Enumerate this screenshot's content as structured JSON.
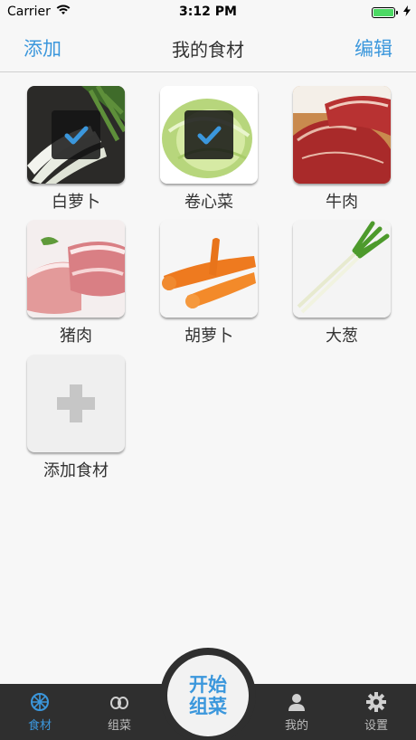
{
  "status": {
    "carrier": "Carrier",
    "time": "3:12 PM"
  },
  "nav": {
    "left": "添加",
    "title": "我的食材",
    "right": "编辑"
  },
  "items": [
    {
      "label": "白萝卜",
      "checked": true
    },
    {
      "label": "卷心菜",
      "checked": true
    },
    {
      "label": "牛肉",
      "checked": false
    },
    {
      "label": "猪肉",
      "checked": false
    },
    {
      "label": "胡萝卜",
      "checked": false
    },
    {
      "label": "大葱",
      "checked": false
    }
  ],
  "add": {
    "label": "添加食材"
  },
  "tabs": [
    {
      "label": "食材",
      "icon": "food-icon",
      "active": true
    },
    {
      "label": "组菜",
      "icon": "combo-icon",
      "active": false
    },
    {
      "label": "我的",
      "icon": "person-icon",
      "active": false
    },
    {
      "label": "设置",
      "icon": "gear-icon",
      "active": false
    }
  ],
  "center": {
    "label": "开始组菜"
  },
  "colors": {
    "accent": "#3b97dc",
    "tabbar": "#2f2f2f"
  }
}
